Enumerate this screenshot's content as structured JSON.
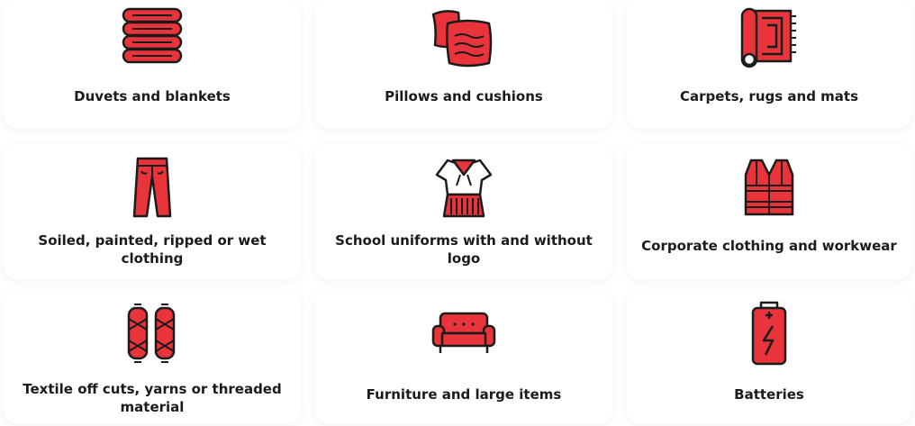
{
  "colors": {
    "accent": "#e8343a",
    "outline": "#1b1b1b",
    "card_background": "#ffffff",
    "text": "#1b1b1b"
  },
  "items": [
    {
      "label": "Duvets and blankets",
      "icon": "folded-blankets-icon"
    },
    {
      "label": "Pillows and cushions",
      "icon": "pillows-icon"
    },
    {
      "label": "Carpets, rugs and mats",
      "icon": "rolled-carpet-icon"
    },
    {
      "label": "Soiled, painted, ripped or wet clothing",
      "icon": "trousers-icon"
    },
    {
      "label": "School uniforms with and without logo",
      "icon": "school-uniform-icon"
    },
    {
      "label": "Corporate clothing and workwear",
      "icon": "safety-vest-icon"
    },
    {
      "label": "Textile off cuts, yarns or threaded material",
      "icon": "yarn-spools-icon"
    },
    {
      "label": "Furniture and large items",
      "icon": "sofa-icon"
    },
    {
      "label": "Batteries",
      "icon": "battery-icon"
    }
  ]
}
